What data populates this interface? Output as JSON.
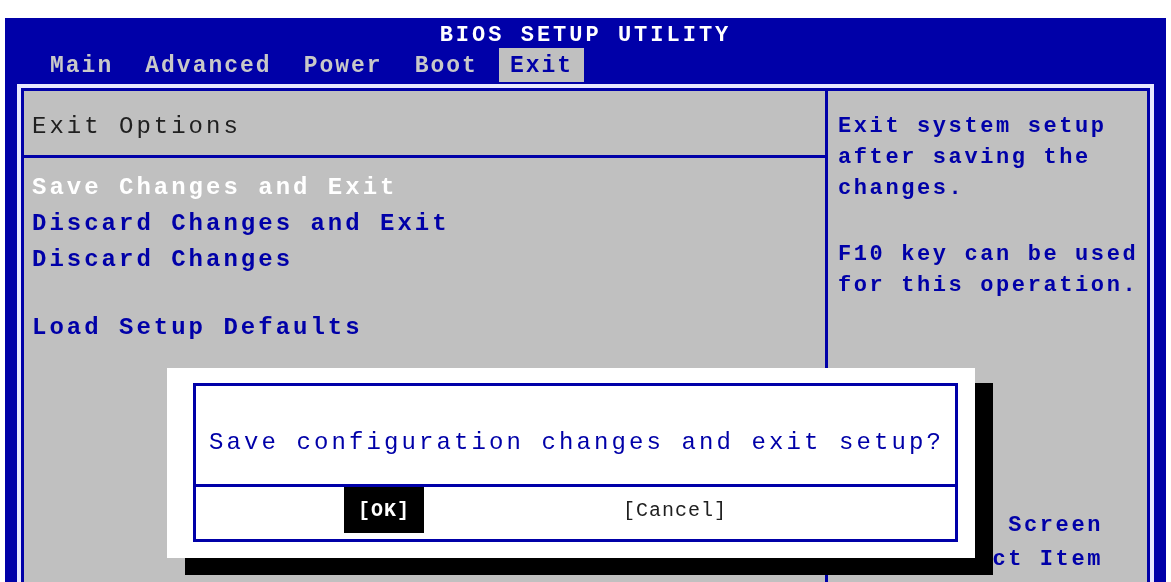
{
  "title": "BIOS SETUP UTILITY",
  "tabs": [
    {
      "label": "Main",
      "selected": false
    },
    {
      "label": "Advanced",
      "selected": false
    },
    {
      "label": "Power",
      "selected": false
    },
    {
      "label": "Boot",
      "selected": false
    },
    {
      "label": "Exit",
      "selected": true
    }
  ],
  "panel": {
    "heading": "Exit Options",
    "item_groups": [
      [
        {
          "label": "Save Changes and Exit",
          "selected": true
        },
        {
          "label": "Discard Changes and Exit",
          "selected": false
        },
        {
          "label": "Discard Changes",
          "selected": false
        }
      ],
      [
        {
          "label": "Load Setup Defaults",
          "selected": false
        }
      ]
    ]
  },
  "help": {
    "paragraphs": [
      "Exit system setup after saving the changes.",
      "F10 key can be used for this operation."
    ],
    "bottom_lines": [
      "Screen",
      "ct Item"
    ]
  },
  "dialog": {
    "message": "Save configuration changes and exit setup?",
    "buttons": [
      {
        "label": "[OK]",
        "selected": true
      },
      {
        "label": "[Cancel]",
        "selected": false
      }
    ]
  }
}
